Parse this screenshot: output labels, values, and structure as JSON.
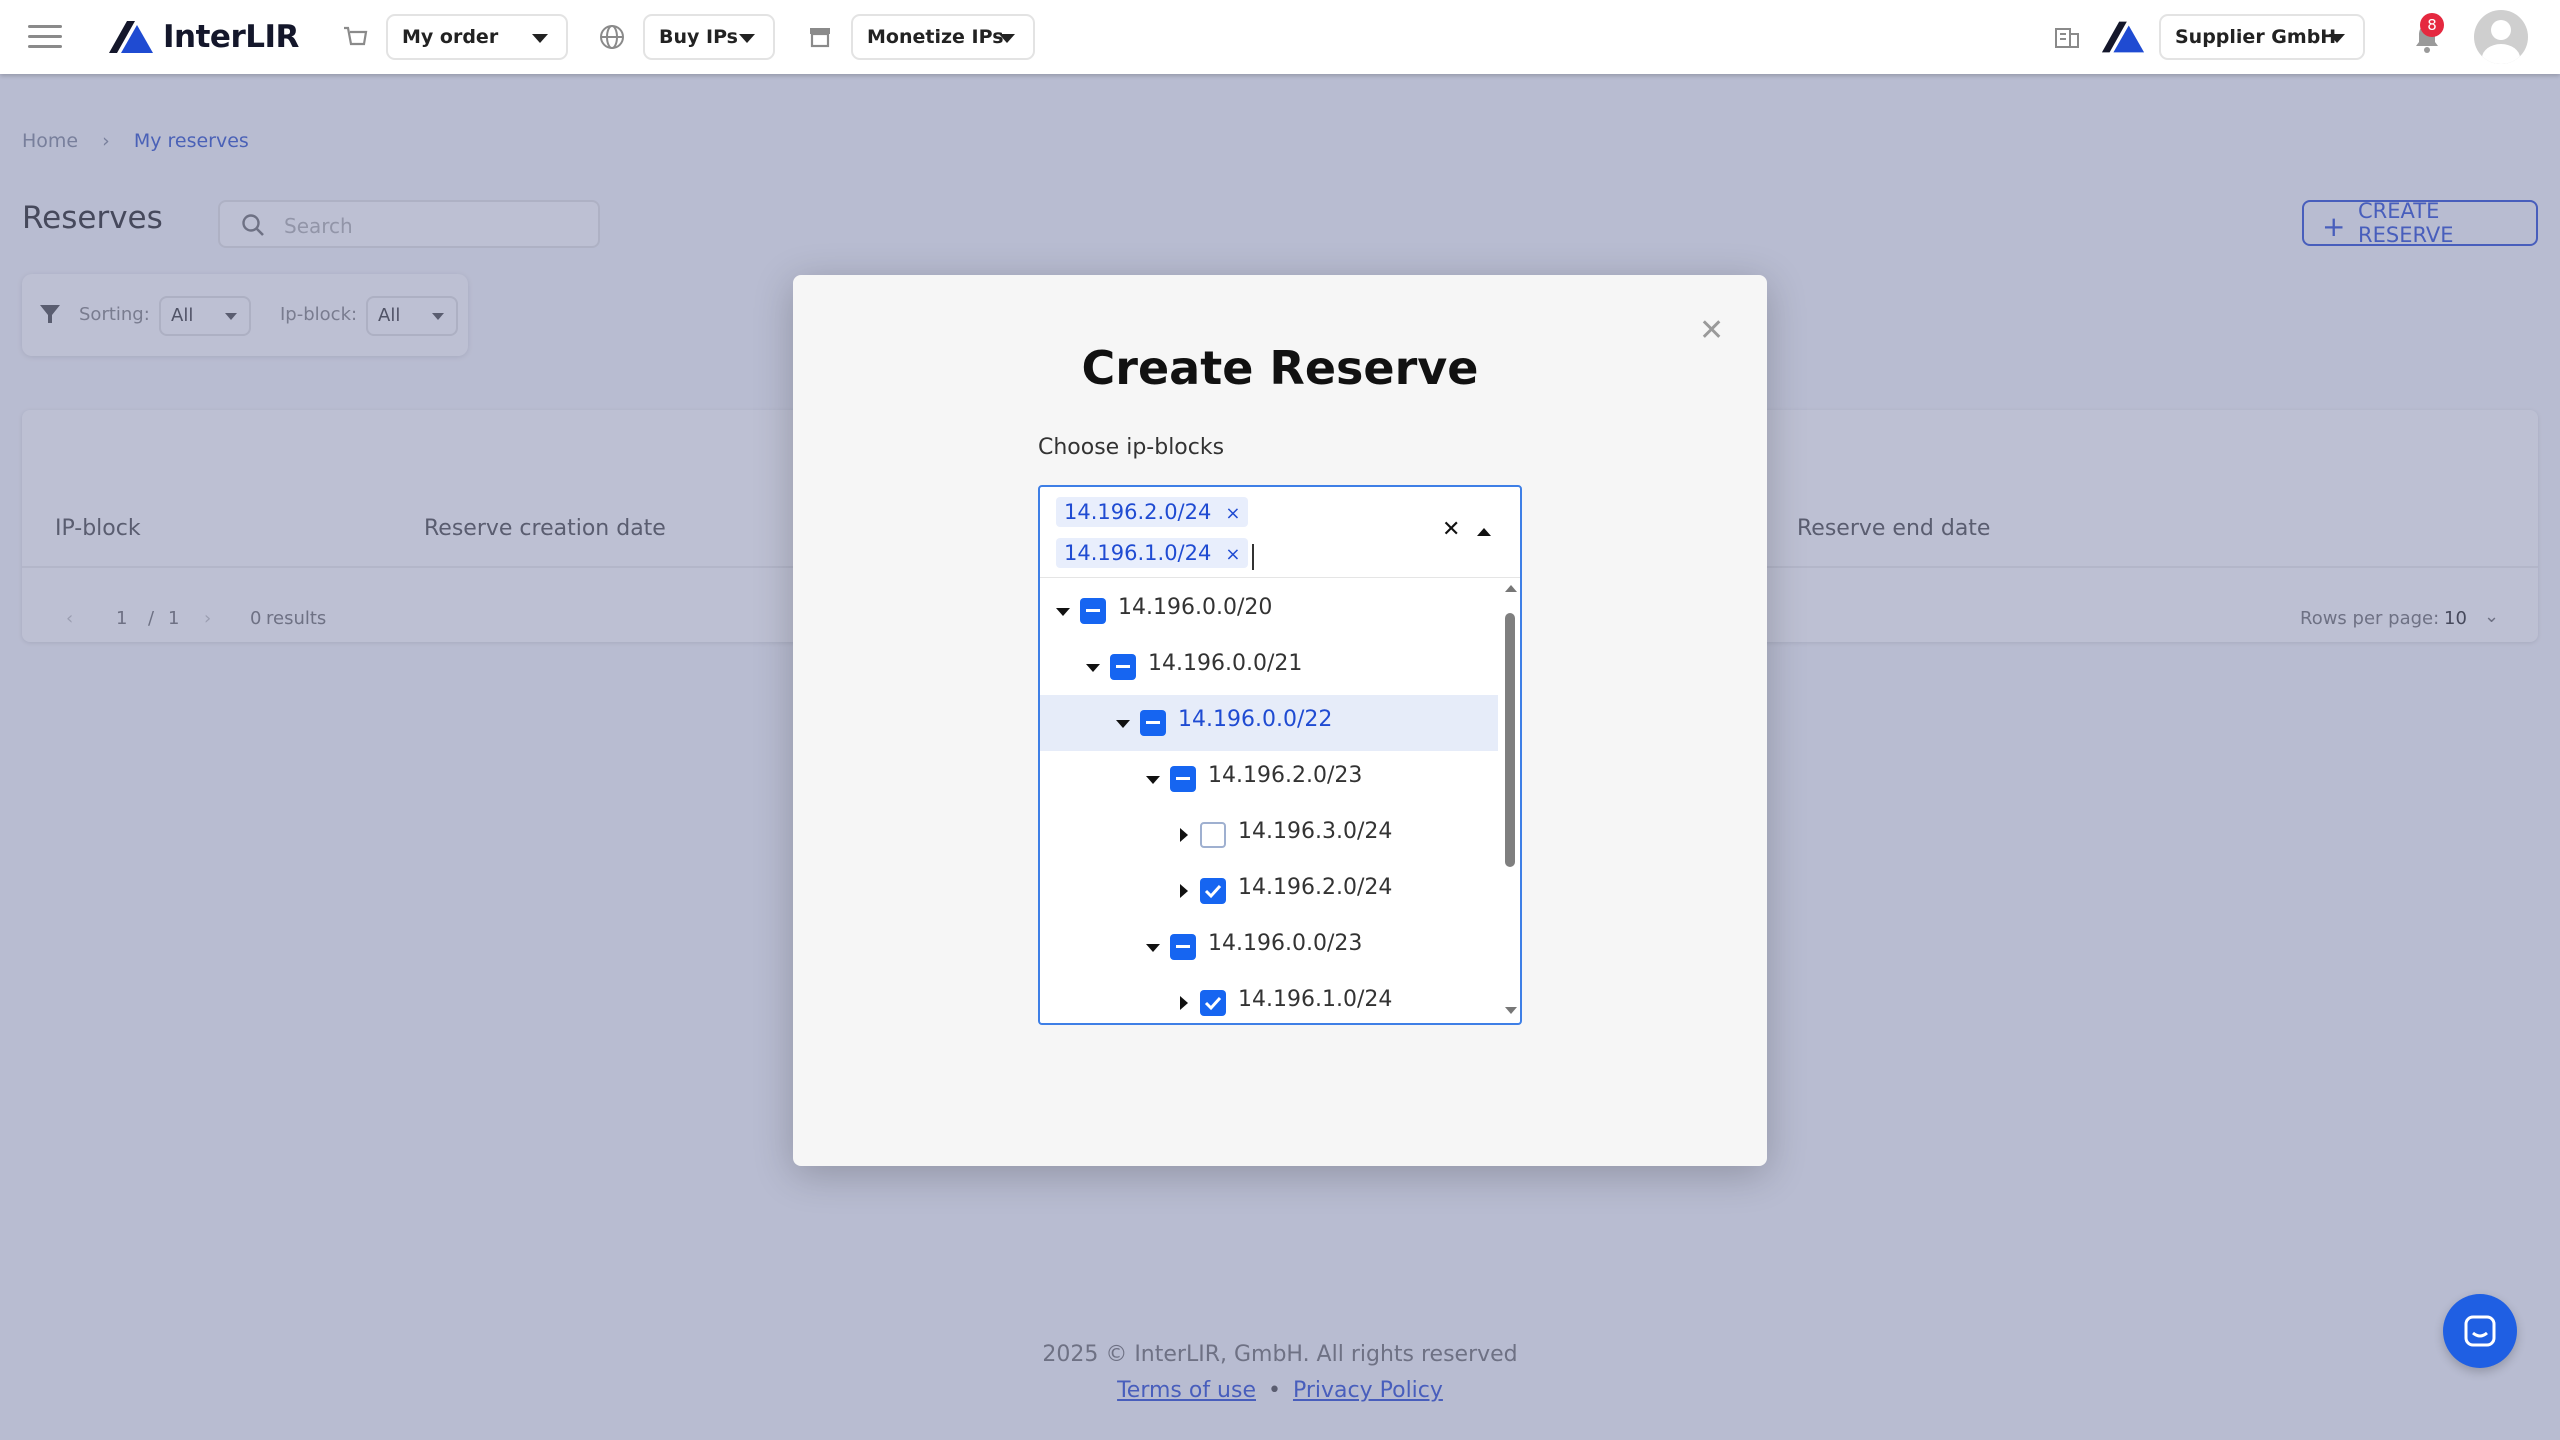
{
  "header": {
    "logo_text": "InterLIR",
    "my_order_label": "My order",
    "buy_ips_label": "Buy IPs",
    "monetize_ips_label": "Monetize IPs",
    "company_label": "Supplier GmbH",
    "notification_count": "8"
  },
  "breadcrumb": {
    "home": "Home",
    "current": "My reserves"
  },
  "reserves": {
    "title": "Reserves",
    "search_placeholder": "Search",
    "create_button": "CREATE RESERVE",
    "filters": {
      "sorting_label": "Sorting:",
      "sorting_value": "All",
      "ipblock_label": "Ip-block:",
      "ipblock_value": "All"
    },
    "table": {
      "columns": [
        "IP-block",
        "Reserve creation date",
        "Reserve end date"
      ],
      "page_current": "1",
      "page_sep": "/",
      "page_total": "1",
      "results_count": "0",
      "results_label": "results",
      "rows_per_page_label": "Rows per page:",
      "rows_per_page_value": "10"
    }
  },
  "modal": {
    "title": "Create Reserve",
    "label": "Choose ip-blocks",
    "chips": [
      "14.196.2.0/24",
      "14.196.1.0/24"
    ],
    "chip_remove": "×",
    "clear_symbol": "✕",
    "tree": [
      {
        "label": "14.196.0.0/20",
        "state": "partial",
        "expanded": true,
        "highlight": false
      },
      {
        "label": "14.196.0.0/21",
        "state": "partial",
        "expanded": true,
        "highlight": false
      },
      {
        "label": "14.196.0.0/22",
        "state": "partial",
        "expanded": true,
        "highlight": true
      },
      {
        "label": "14.196.2.0/23",
        "state": "partial",
        "expanded": true,
        "highlight": false
      },
      {
        "label": "14.196.3.0/24",
        "state": "unchecked",
        "expanded": false,
        "highlight": false
      },
      {
        "label": "14.196.2.0/24",
        "state": "checked",
        "expanded": false,
        "highlight": false
      },
      {
        "label": "14.196.0.0/23",
        "state": "partial",
        "expanded": true,
        "highlight": false
      },
      {
        "label": "14.196.1.0/24",
        "state": "checked",
        "expanded": false,
        "highlight": false
      }
    ]
  },
  "footer": {
    "copyright": "2025 © InterLIR, GmbH. All rights reserved",
    "terms": "Terms of use",
    "separator": "•",
    "privacy": "Privacy Policy"
  },
  "colors": {
    "accent": "#1665F1",
    "brand_link": "#3657D8",
    "badge": "#E5283F",
    "overlay": "#626A96"
  }
}
